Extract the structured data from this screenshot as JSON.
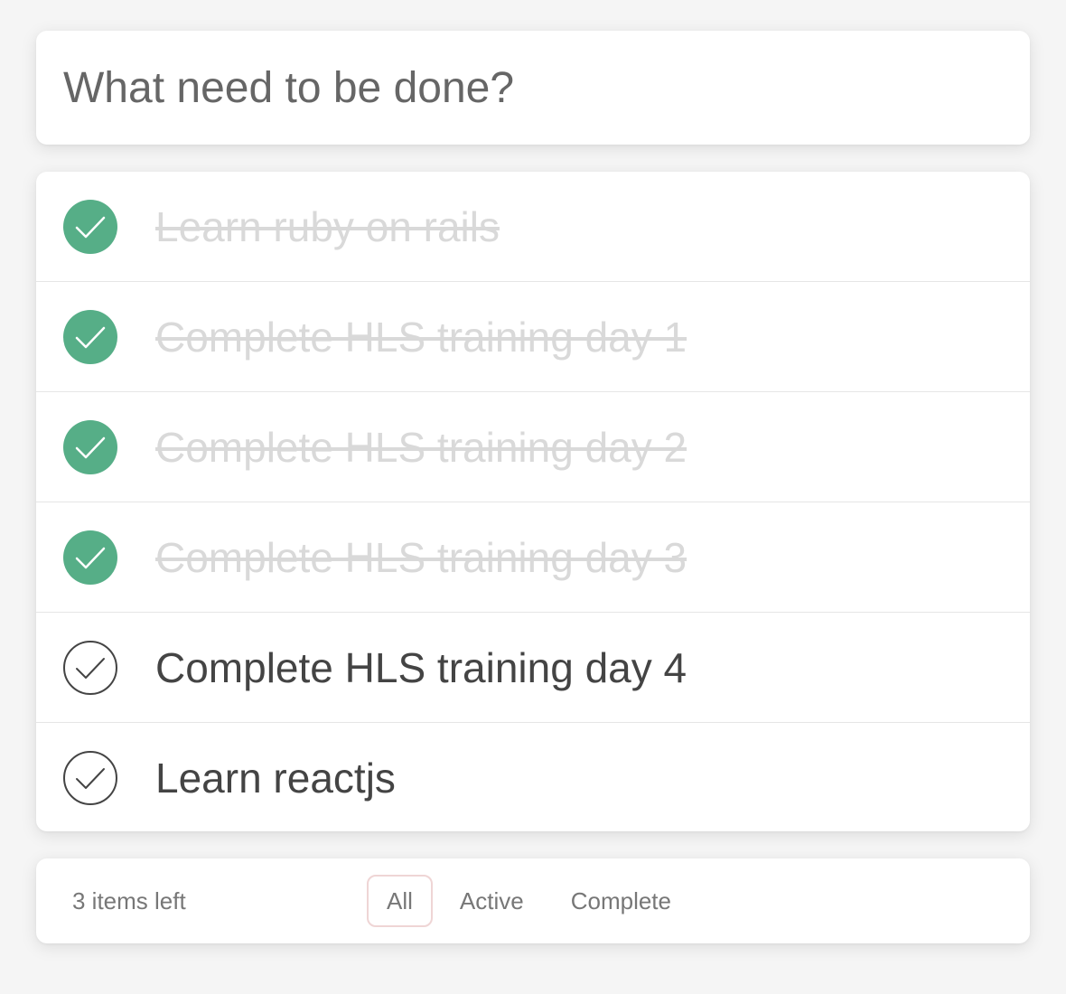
{
  "new_todo": {
    "placeholder": "What need to be done?"
  },
  "todos": [
    {
      "label": "Learn ruby on rails",
      "completed": true
    },
    {
      "label": "Complete HLS training day 1",
      "completed": true
    },
    {
      "label": "Complete HLS training day 2",
      "completed": true
    },
    {
      "label": "Complete HLS training day 3",
      "completed": true
    },
    {
      "label": "Complete HLS training day 4",
      "completed": false
    },
    {
      "label": "Learn reactjs",
      "completed": false
    }
  ],
  "footer": {
    "count_text": "3 items left",
    "filters": [
      {
        "label": "All",
        "selected": true
      },
      {
        "label": "Active",
        "selected": false
      },
      {
        "label": "Complete",
        "selected": false
      }
    ]
  },
  "colors": {
    "done_check_bg": "#56ae87",
    "done_text": "#d9d9d9",
    "open_text": "#444444",
    "selected_filter_border": "#efd5d5"
  },
  "icons": {
    "done_toggle": "check-circle-filled-icon",
    "open_toggle": "check-circle-outline-icon"
  }
}
